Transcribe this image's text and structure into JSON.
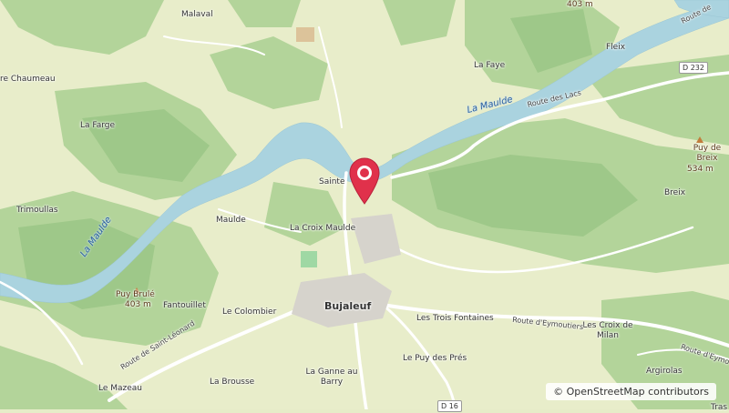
{
  "map": {
    "places": {
      "malaval": "Malaval",
      "chaumeau": "re Chaumeau",
      "la_farge": "La Farge",
      "trimouillas": "Trimoullas",
      "maulde": "Maulde",
      "sainte": "Sainte",
      "la_croix_maulde": "La Croix Maulde",
      "bujaleuf": "Bujaleuf",
      "le_colombier": "Le Colombier",
      "fantouillet": "Fantouillet",
      "la_brousse": "La Brousse",
      "le_mazeau": "Le Mazeau",
      "la_ganne": "La Ganne au Barry",
      "le_puy_des_pres": "Le Puy des Prés",
      "les_trois_fontaines": "Les Trois Fontaines",
      "les_croix_de_milan": "Les Croix de Milan",
      "argirolas": "Argirolas",
      "la_faye": "La Faye",
      "fleix": "Fleix",
      "breix": "Breix",
      "tras": "Tras"
    },
    "peaks": {
      "puy_brule_name": "Puy Brulé",
      "puy_brule_alt": "403 m",
      "puy_de_breix_name": "Puy de Breix",
      "puy_de_breix_alt": "534 m",
      "top_alt": "403 m"
    },
    "rivers": {
      "maulde_west": "La Maulde",
      "maulde_east": "La Maulde"
    },
    "roads": {
      "route_des_lacs": "Route des Lacs",
      "route_de_saint_leonard": "Route de Saint-Léonard",
      "route_d_eymoutiers": "Route d'Eymoutiers",
      "route_d_eymo": "Route d'Eymo",
      "route_de_top": "Route de",
      "d232": "D 232",
      "d16": "D 16"
    },
    "attribution": "© OpenStreetMap contributors",
    "colors": {
      "water": "#aad3df",
      "forest": "#a9d18e",
      "meadow": "#e6ecc8",
      "pin": "#e0314b"
    }
  }
}
